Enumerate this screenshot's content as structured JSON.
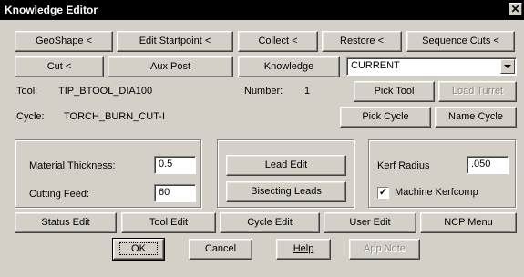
{
  "window": {
    "title": "Knowledge Editor",
    "close_glyph": "✕"
  },
  "row1": [
    "GeoShape <",
    "Edit Startpoint <",
    "Collect <",
    "Restore <",
    "Sequence Cuts <"
  ],
  "row2": {
    "cut": "Cut <",
    "aux_post": "Aux Post",
    "knowledge": "Knowledge",
    "combo_value": "CURRENT"
  },
  "tool": {
    "label": "Tool:",
    "value": "TIP_BTOOL_DIA100",
    "number_label": "Number:",
    "number_value": "1",
    "pick_tool": "Pick Tool",
    "load_turret": "Load Turret"
  },
  "cycle": {
    "label": "Cycle:",
    "value": "TORCH_BURN_CUT-I",
    "pick_cycle": "Pick Cycle",
    "name_cycle": "Name Cycle"
  },
  "params": {
    "material_label": "Material Thickness:",
    "material_value": "0.5",
    "feed_label": "Cutting Feed:",
    "feed_value": "60"
  },
  "leads": {
    "lead_edit": "Lead Edit",
    "bisecting": "Bisecting Leads"
  },
  "kerf": {
    "radius_label": "Kerf Radius",
    "radius_value": ".050",
    "comp_label": "Machine Kerfcomp",
    "comp_checked": true,
    "check_glyph": "✓"
  },
  "row_bottom": [
    "Status Edit",
    "Tool Edit",
    "Cycle Edit",
    "User Edit",
    "NCP Menu"
  ],
  "dialog": {
    "ok": "OK",
    "cancel": "Cancel",
    "help": "Help",
    "app_note": "App Note"
  }
}
